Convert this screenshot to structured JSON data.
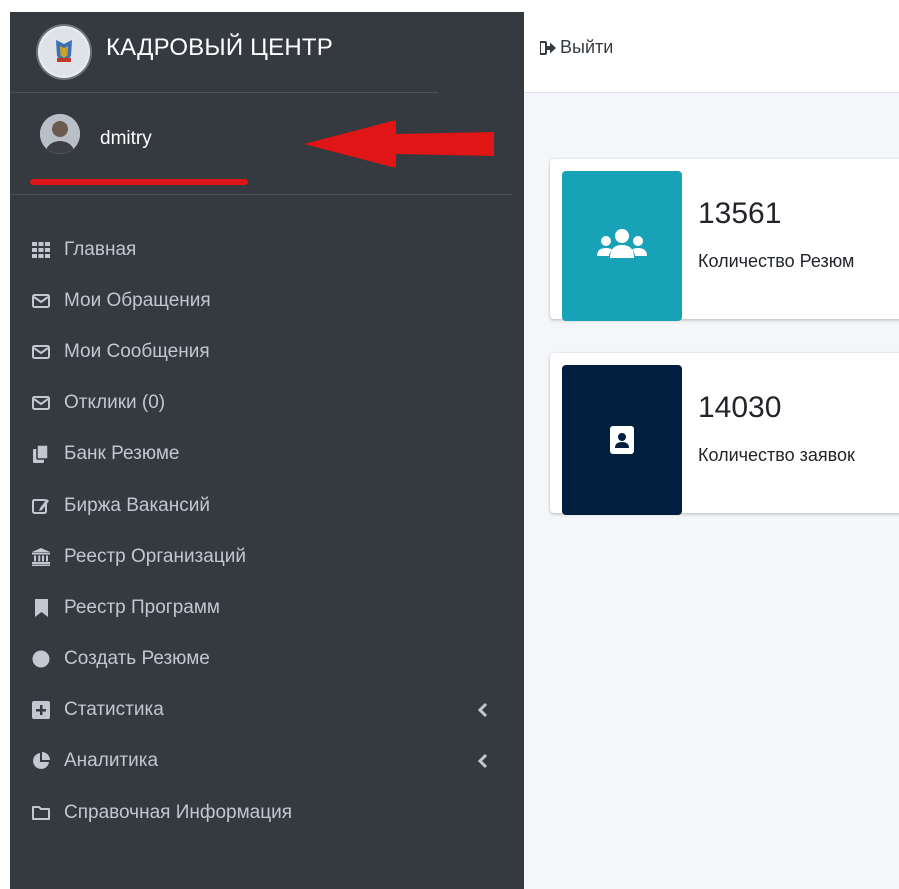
{
  "brand": {
    "title": "КАДРОВЫЙ ЦЕНТР",
    "logo_icon": "emblem-logo-icon"
  },
  "user": {
    "name": "dmitry",
    "annotation_color": "#e01515"
  },
  "topbar": {
    "logout_label": "Выйти",
    "logout_icon": "sign-out-icon"
  },
  "sidebar": {
    "items": [
      {
        "label": "Главная",
        "icon": "grid-icon"
      },
      {
        "label": "Мои Обращения",
        "icon": "envelope-icon"
      },
      {
        "label": "Мои Сообщения",
        "icon": "envelope-icon"
      },
      {
        "label": "Отклики (0)",
        "icon": "envelope-icon"
      },
      {
        "label": "Банк Резюме",
        "icon": "copy-icon"
      },
      {
        "label": "Биржа Вакансий",
        "icon": "edit-icon"
      },
      {
        "label": "Реестр Организаций",
        "icon": "university-icon"
      },
      {
        "label": "Реестр Программ",
        "icon": "bookmark-icon"
      },
      {
        "label": "Создать Резюме",
        "icon": "circle-icon"
      },
      {
        "label": "Статистика",
        "icon": "plus-square-icon"
      },
      {
        "label": "Аналитика",
        "icon": "pie-chart-icon"
      },
      {
        "label": "Справочная Информация",
        "icon": "folder-icon"
      }
    ]
  },
  "cards": [
    {
      "number": "13561",
      "label": "Количество Резюм",
      "color": "#17a2b8",
      "icon": "users-icon"
    },
    {
      "number": "14030",
      "label": "Количество заявок",
      "color": "#001f3f",
      "icon": "id-badge-icon"
    }
  ],
  "colors": {
    "sidebar": "#343a40",
    "content_bg": "#f4f6f9"
  }
}
